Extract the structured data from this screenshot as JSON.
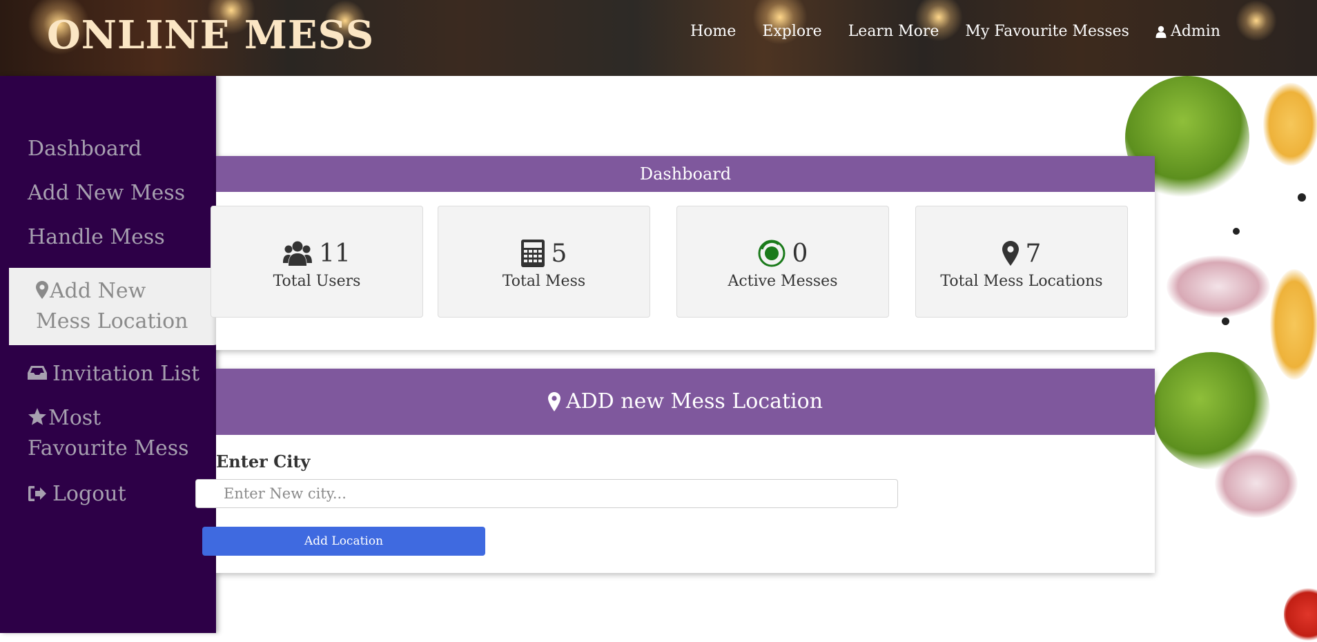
{
  "brand": "ONLINE MESS",
  "nav": {
    "items": [
      "Home",
      "Explore",
      "Learn More",
      "My Favourite Messes"
    ],
    "admin_label": "Admin"
  },
  "sidebar": {
    "items": [
      {
        "label": "Dashboard",
        "icon": ""
      },
      {
        "label": "Add New Mess",
        "icon": ""
      },
      {
        "label": "Handle Mess",
        "icon": ""
      },
      {
        "label": "Add New Mess Location",
        "icon": "map-marker-icon",
        "active": true
      },
      {
        "label": "Invitation List",
        "icon": "inbox-icon"
      },
      {
        "label": "Most Favourite Mess",
        "icon": "star-icon"
      },
      {
        "label": "Logout",
        "icon": "sign-out-icon"
      }
    ]
  },
  "dashboard": {
    "title": "Dashboard",
    "stats": [
      {
        "value": "11",
        "label": "Total Users",
        "icon": "users-icon"
      },
      {
        "value": "5",
        "label": "Total Mess",
        "icon": "calculator-icon"
      },
      {
        "value": "0",
        "label": "Active Messes",
        "icon": "active-circle-icon"
      },
      {
        "value": "7",
        "label": "Total Mess Locations",
        "icon": "map-marker-icon"
      }
    ]
  },
  "location_form": {
    "title": "ADD new Mess Location",
    "field_label": "Enter City",
    "input_value": "",
    "input_placeholder": "Enter New city...",
    "submit_label": "Add Location"
  },
  "colors": {
    "sidebar_bg": "#2d0047",
    "panel_header": "#7f589d",
    "brand_text": "#fbe6c4",
    "button_blue": "#3f6ae0",
    "active_green": "#1a7a1a"
  }
}
